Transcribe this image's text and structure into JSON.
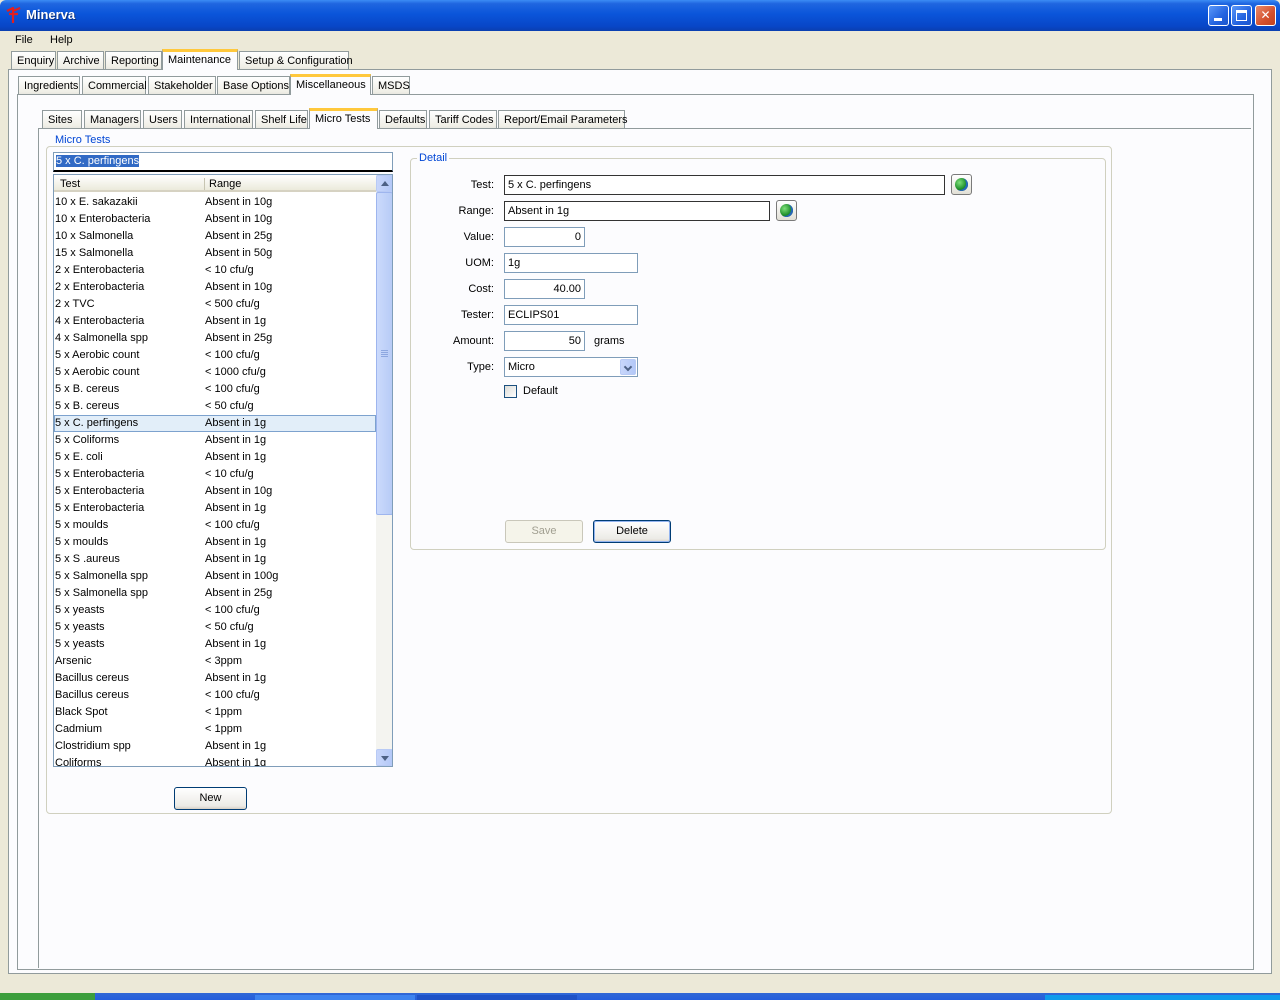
{
  "window": {
    "title": "Minerva"
  },
  "menu": [
    "File",
    "Help"
  ],
  "main_tabs": [
    "Enquiry",
    "Archive",
    "Reporting",
    "Maintenance",
    "Setup & Configuration"
  ],
  "sub_tabs": [
    "Ingredients",
    "Commercial",
    "Stakeholder",
    "Base Options",
    "Miscellaneous",
    "MSDS"
  ],
  "misc_tabs": [
    "Sites",
    "Managers",
    "Users",
    "International",
    "Shelf Life",
    "Micro Tests",
    "Defaults",
    "Tariff Codes",
    "Report/Email Parameters"
  ],
  "micro_tests": {
    "group_label": "Micro Tests",
    "search_value": "5 x C. perfingens",
    "columns": [
      "Test",
      "Range"
    ],
    "rows": [
      [
        "10 x E. sakazakii",
        "Absent in 10g"
      ],
      [
        "10 x Enterobacteria",
        "Absent in 10g"
      ],
      [
        "10 x Salmonella",
        "Absent in 25g"
      ],
      [
        "15 x Salmonella",
        "Absent in 50g"
      ],
      [
        "2 x Enterobacteria",
        "< 10 cfu/g"
      ],
      [
        "2 x Enterobacteria",
        "Absent in 10g"
      ],
      [
        "2 x TVC",
        "< 500 cfu/g"
      ],
      [
        "4 x Enterobacteria",
        "Absent in 1g"
      ],
      [
        "4 x Salmonella spp",
        "Absent in 25g"
      ],
      [
        "5 x Aerobic count",
        "< 100 cfu/g"
      ],
      [
        "5 x Aerobic count",
        "< 1000 cfu/g"
      ],
      [
        "5 x B. cereus",
        "< 100 cfu/g"
      ],
      [
        "5 x B. cereus",
        "< 50 cfu/g"
      ],
      [
        "5 x C. perfingens",
        "Absent in 1g"
      ],
      [
        "5 x Coliforms",
        "Absent in 1g"
      ],
      [
        "5 x E. coli",
        "Absent in 1g"
      ],
      [
        "5 x Enterobacteria",
        "< 10 cfu/g"
      ],
      [
        "5 x Enterobacteria",
        "Absent in 10g"
      ],
      [
        "5 x Enterobacteria",
        "Absent in 1g"
      ],
      [
        "5 x moulds",
        "< 100 cfu/g"
      ],
      [
        "5 x moulds",
        "Absent in 1g"
      ],
      [
        "5 x S .aureus",
        "Absent in 1g"
      ],
      [
        "5 x Salmonella spp",
        "Absent in 100g"
      ],
      [
        "5 x Salmonella spp",
        "Absent in 25g"
      ],
      [
        "5 x yeasts",
        "< 100 cfu/g"
      ],
      [
        "5 x yeasts",
        "< 50 cfu/g"
      ],
      [
        "5 x yeasts",
        "Absent in 1g"
      ],
      [
        "Arsenic",
        "< 3ppm"
      ],
      [
        "Bacillus cereus",
        "Absent in 1g"
      ],
      [
        "Bacillus cereus",
        "< 100 cfu/g"
      ],
      [
        "Black Spot",
        "< 1ppm"
      ],
      [
        "Cadmium",
        "< 1ppm"
      ],
      [
        "Clostridium spp",
        "Absent in 1g"
      ],
      [
        "Coliforms",
        "Absent in 1g"
      ]
    ],
    "selected_index": 13,
    "new_label": "New"
  },
  "detail": {
    "group_label": "Detail",
    "test_label": "Test:",
    "test_value": "5 x C. perfingens",
    "range_label": "Range:",
    "range_value": "Absent in 1g",
    "value_label": "Value:",
    "value_value": "0",
    "uom_label": "UOM:",
    "uom_value": "1g",
    "cost_label": "Cost:",
    "cost_value": "40.00",
    "tester_label": "Tester:",
    "tester_value": "ECLIPS01",
    "amount_label": "Amount:",
    "amount_value": "50",
    "amount_unit": "grams",
    "type_label": "Type:",
    "type_value": "Micro",
    "default_label": "Default",
    "save_label": "Save",
    "delete_label": "Delete"
  },
  "icons": [
    "app-icon",
    "globe-icon",
    "chevron-down-icon",
    "scroll-up-icon",
    "scroll-down-icon"
  ]
}
